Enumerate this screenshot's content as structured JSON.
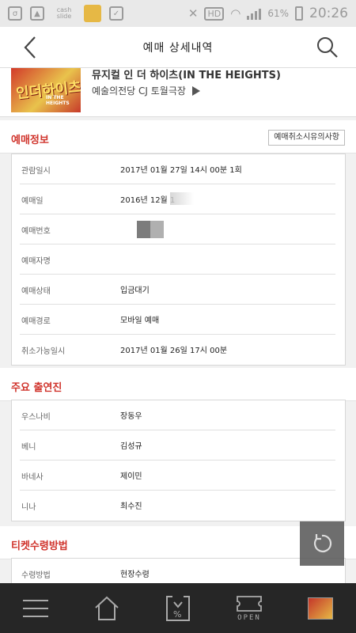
{
  "status_bar": {
    "cash_slide_label": "cash slide",
    "hd_label": "HD",
    "battery_percent": "61%",
    "time": "20:26"
  },
  "header": {
    "title": "예매 상세내역",
    "back_icon": "chevron-left-icon",
    "search_icon": "search-icon"
  },
  "event": {
    "title": "뮤지컬 인 더 하이츠(IN THE HEIGHTS)",
    "venue": "예술의전당 CJ 토월극장",
    "poster_text": "인더하이츠",
    "poster_sub": "IN THE HEIGHTS"
  },
  "booking_info": {
    "section_title": "예매정보",
    "notice_button": "예매취소시유의사항",
    "rows": [
      {
        "label": "관람일시",
        "value": "2017년 01월 27일 14시 00분 1회"
      },
      {
        "label": "예매일",
        "value": "2016년 12월 1"
      },
      {
        "label": "예매번호",
        "value": ""
      },
      {
        "label": "예매자명",
        "value": ""
      },
      {
        "label": "예매상태",
        "value": "입금대기"
      },
      {
        "label": "예매경로",
        "value": "모바일 예매"
      },
      {
        "label": "취소가능일시",
        "value": "2017년 01월 26일 17시 00분"
      }
    ]
  },
  "cast": {
    "section_title": "주요 출연진",
    "rows": [
      {
        "label": "우스나비",
        "value": "장동우"
      },
      {
        "label": "베니",
        "value": "김성규"
      },
      {
        "label": "바네사",
        "value": "제이민"
      },
      {
        "label": "니나",
        "value": "최수진"
      }
    ]
  },
  "ticket_receive": {
    "section_title": "티켓수령방법",
    "rows": [
      {
        "label": "수령방법",
        "value": "현장수령"
      }
    ]
  },
  "bottom_nav": {
    "items": [
      "menu-icon",
      "home-icon",
      "discount-icon",
      "open-ticket-icon",
      "recent-thumbnail"
    ],
    "open_label": "OPEN"
  },
  "colors": {
    "accent_red": "#d0342c",
    "nav_bg": "#262626"
  }
}
